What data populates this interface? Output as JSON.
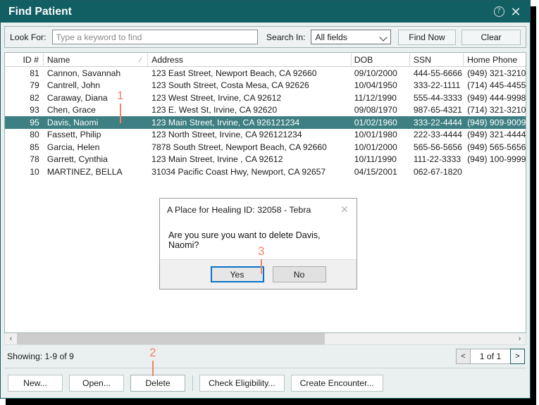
{
  "window": {
    "title": "Find Patient",
    "help_icon": "help-circle-icon",
    "help_glyph": "?",
    "close_glyph": "✕",
    "accent_color": "#115e63",
    "selection_color": "#3d7f83",
    "annotation_color": "#f3836a"
  },
  "search": {
    "look_for_label": "Look For:",
    "look_for_value": "",
    "look_for_placeholder": "Type a keyword to find",
    "search_in_label": "Search In:",
    "search_in_value": "All fields",
    "search_in_options": [
      "All fields"
    ],
    "find_now_label": "Find Now",
    "clear_label": "Clear"
  },
  "grid": {
    "columns": [
      {
        "key": "id",
        "label": "ID #"
      },
      {
        "key": "name",
        "label": "Name",
        "sorted": "ascending"
      },
      {
        "key": "address",
        "label": "Address"
      },
      {
        "key": "dob",
        "label": "DOB"
      },
      {
        "key": "ssn",
        "label": "SSN"
      },
      {
        "key": "phone",
        "label": "Home Phone"
      }
    ],
    "rows": [
      {
        "id": "81",
        "name": "Cannon, Savannah",
        "address": "123 East Street, Newport Beach, CA  92660",
        "dob": "09/10/2000",
        "ssn": "444-55-6666",
        "phone": "(949) 321-3210",
        "selected": false
      },
      {
        "id": "79",
        "name": "Cantrell, John",
        "address": "123 South Street, Costa Mesa, CA  92626",
        "dob": "10/04/1950",
        "ssn": "333-22-1111",
        "phone": "(714) 445-4455",
        "selected": false
      },
      {
        "id": "82",
        "name": "Caraway, Diana",
        "address": "123 West Street, Irvine, CA  92612",
        "dob": "11/12/1990",
        "ssn": "555-44-3333",
        "phone": "(949) 444-9998",
        "selected": false
      },
      {
        "id": "93",
        "name": "Chen, Grace",
        "address": "123 E. West St, Irvine, CA  92620",
        "dob": "09/08/1970",
        "ssn": "987-65-4321",
        "phone": "(714) 321-3210",
        "selected": false
      },
      {
        "id": "95",
        "name": "Davis, Naomi",
        "address": "123 Main Street, Irvine, CA  926121234",
        "dob": "01/02/1960",
        "ssn": "333-22-4444",
        "phone": "(949) 909-9009",
        "selected": true
      },
      {
        "id": "80",
        "name": "Fassett, Philip",
        "address": "123 North Street, Irvine, CA  926121234",
        "dob": "10/01/1980",
        "ssn": "222-33-4444",
        "phone": "(949) 321-4444",
        "selected": false
      },
      {
        "id": "85",
        "name": "Garcia, Helen",
        "address": "7878 South Street, Newport Beach, CA  92660",
        "dob": "10/01/2000",
        "ssn": "565-56-5656",
        "phone": "(949) 565-5656",
        "selected": false
      },
      {
        "id": "78",
        "name": "Garrett, Cynthia",
        "address": "123 Main Street, Irvine , CA  92612",
        "dob": "10/11/1990",
        "ssn": "111-22-3333",
        "phone": "(949) 100-9999",
        "selected": false
      },
      {
        "id": "10",
        "name": "MARTINEZ, BELLA",
        "address": "31034 Pacific Coast Hwy, Newport, CA  92657",
        "dob": "04/15/2001",
        "ssn": "062-67-1820",
        "phone": "",
        "selected": false
      }
    ]
  },
  "scrollbar": {
    "left_arrow": "‹",
    "right_arrow": "›"
  },
  "status": {
    "showing": "Showing: 1-9 of 9",
    "pager_prev": "<",
    "pager_label": "1 of 1",
    "pager_next": ">"
  },
  "actions": {
    "new": "New...",
    "open": "Open...",
    "delete": "Delete",
    "check_eligibility": "Check Eligibility...",
    "create_encounter": "Create Encounter..."
  },
  "dialog": {
    "title": "A Place for Healing ID: 32058 - Tebra",
    "close_glyph": "✕",
    "message": "Are you sure you want to delete Davis, Naomi?",
    "yes_label": "Yes",
    "no_label": "No"
  },
  "annotations": [
    {
      "id": "1",
      "label": "1"
    },
    {
      "id": "2",
      "label": "2"
    },
    {
      "id": "3",
      "label": "3"
    }
  ]
}
